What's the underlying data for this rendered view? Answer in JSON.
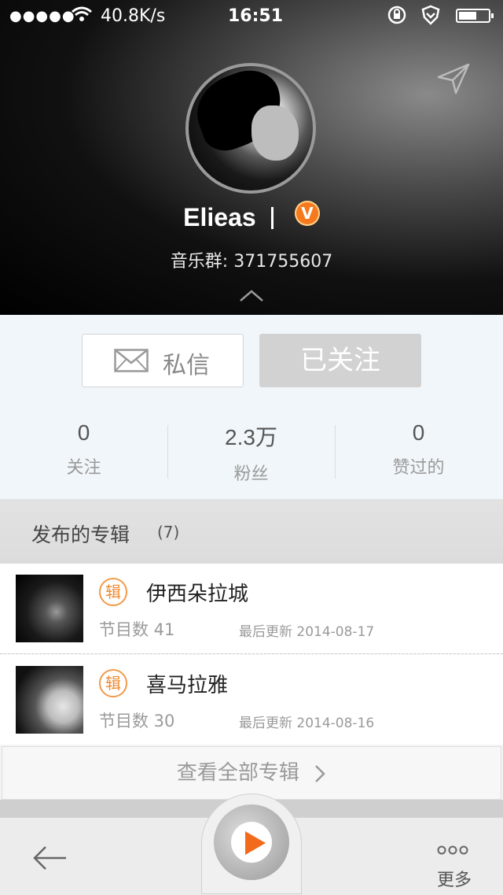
{
  "status_bar": {
    "signal": "●●●●●",
    "speed": "40.8K/s",
    "time": "16:51"
  },
  "profile": {
    "username": "Elieas",
    "badge": "V",
    "group_label": "音乐群:",
    "group_number": "371755607"
  },
  "actions": {
    "message_label": "私信",
    "follow_label": "已关注"
  },
  "stats": [
    {
      "value": "0",
      "label": "关注"
    },
    {
      "value": "2.3万",
      "label": "粉丝"
    },
    {
      "value": "0",
      "label": "赞过的"
    }
  ],
  "albums": {
    "title": "发布的专辑",
    "count": "(7)",
    "tag": "辑",
    "items": [
      {
        "name": "伊西朵拉城",
        "programs": "节目数 41",
        "updated": "最后更新 2014-08-17"
      },
      {
        "name": "喜马拉雅",
        "programs": "节目数 30",
        "updated": "最后更新 2014-08-16"
      }
    ],
    "see_all": "查看全部专辑"
  },
  "bottom_bar": {
    "more_label": "更多"
  },
  "colors": {
    "accent": "#f26b1d",
    "follow_bg": "#d2d2d2",
    "badge": "#f7791e"
  }
}
